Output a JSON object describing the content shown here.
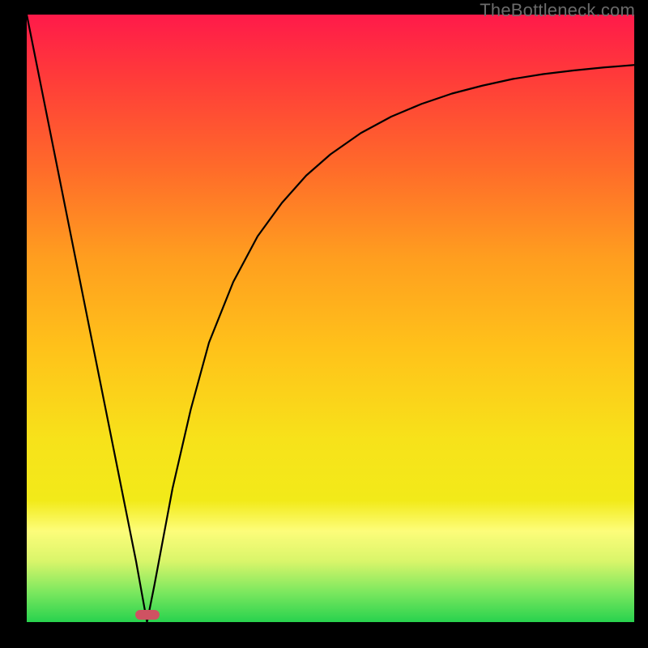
{
  "watermark": "TheBottleneck.com",
  "chart_data": {
    "type": "line",
    "title": "",
    "xlabel": "",
    "ylabel": "",
    "xlim": [
      0,
      100
    ],
    "ylim": [
      0,
      100
    ],
    "grid": false,
    "legend": false,
    "series": [
      {
        "name": "curve",
        "x": [
          0,
          3,
          6,
          9,
          12,
          15,
          18,
          19.8,
          21,
          24,
          27,
          30,
          34,
          38,
          42,
          46,
          50,
          55,
          60,
          65,
          70,
          75,
          80,
          85,
          90,
          95,
          100
        ],
        "y": [
          100,
          85,
          70,
          55,
          40,
          25,
          10,
          0,
          6,
          22,
          35,
          46,
          56,
          63.5,
          69,
          73.5,
          77,
          80.5,
          83.2,
          85.3,
          87,
          88.3,
          89.4,
          90.2,
          90.8,
          91.3,
          91.7
        ]
      }
    ],
    "marker": {
      "x_center_pct": 19.8,
      "width_pct": 4.0
    },
    "background_gradient": {
      "top": "#ff1a4a",
      "mid": "#f7e21a",
      "bottom": "#28d24e"
    }
  }
}
